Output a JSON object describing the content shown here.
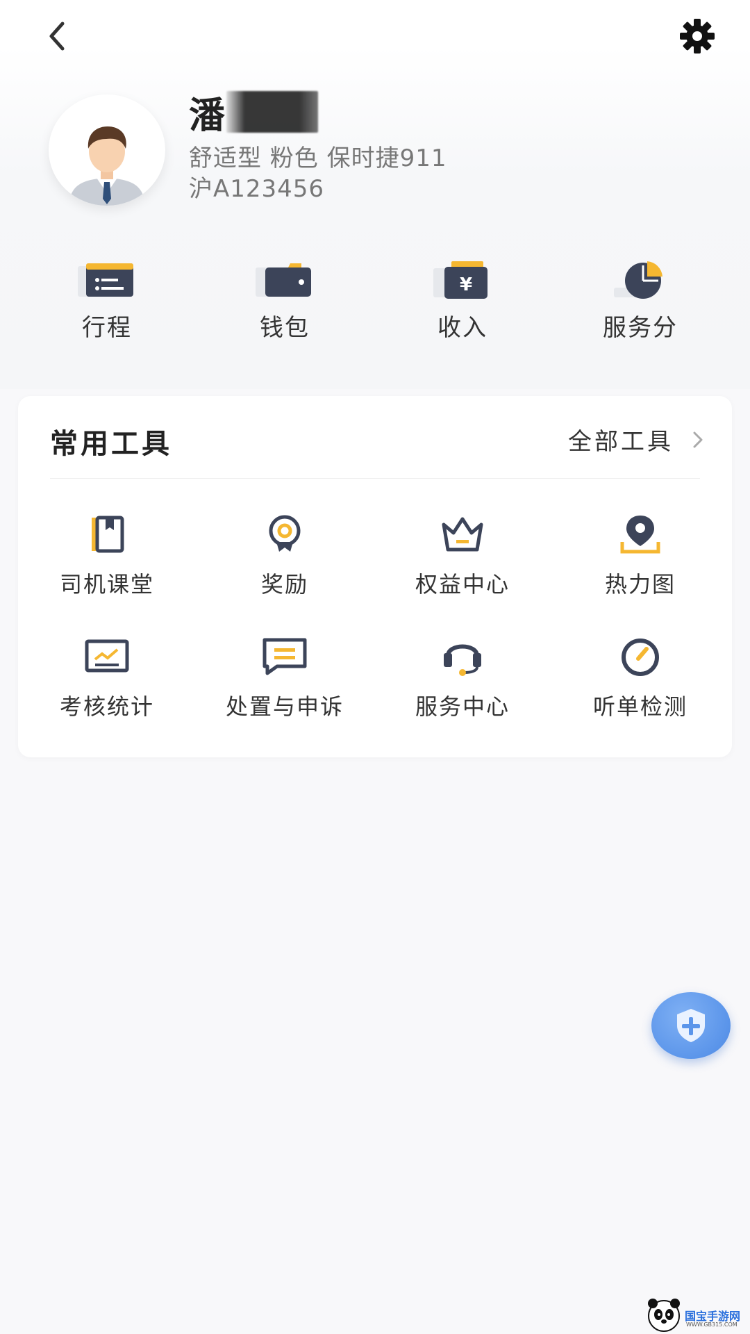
{
  "header": {
    "back_icon": "chevron-left-icon",
    "settings_icon": "gear-icon"
  },
  "profile": {
    "name": "潘",
    "car_info": "舒适型 粉色 保时捷911",
    "plate": "沪A123456"
  },
  "quick_actions": [
    {
      "label": "行程",
      "icon": "itinerary-card-icon"
    },
    {
      "label": "钱包",
      "icon": "wallet-icon"
    },
    {
      "label": "收入",
      "icon": "income-yen-icon"
    },
    {
      "label": "服务分",
      "icon": "pie-score-icon"
    }
  ],
  "tools_card": {
    "title": "常用工具",
    "all_tools_label": "全部工具",
    "items": [
      {
        "label": "司机课堂",
        "icon": "book-icon"
      },
      {
        "label": "奖励",
        "icon": "award-badge-icon"
      },
      {
        "label": "权益中心",
        "icon": "crown-icon"
      },
      {
        "label": "热力图",
        "icon": "location-pin-icon"
      },
      {
        "label": "考核统计",
        "icon": "chart-board-icon"
      },
      {
        "label": "处置与申诉",
        "icon": "message-icon"
      },
      {
        "label": "服务中心",
        "icon": "headset-icon"
      },
      {
        "label": "听单检测",
        "icon": "gauge-icon"
      }
    ]
  },
  "fab": {
    "icon": "shield-plus-icon"
  },
  "watermark": {
    "text": "国宝手游网",
    "sub": "WWW.GB315.COM"
  },
  "colors": {
    "accent": "#f5b731",
    "icon_dark": "#3c4459",
    "fab_blue": "#5b95ea"
  }
}
